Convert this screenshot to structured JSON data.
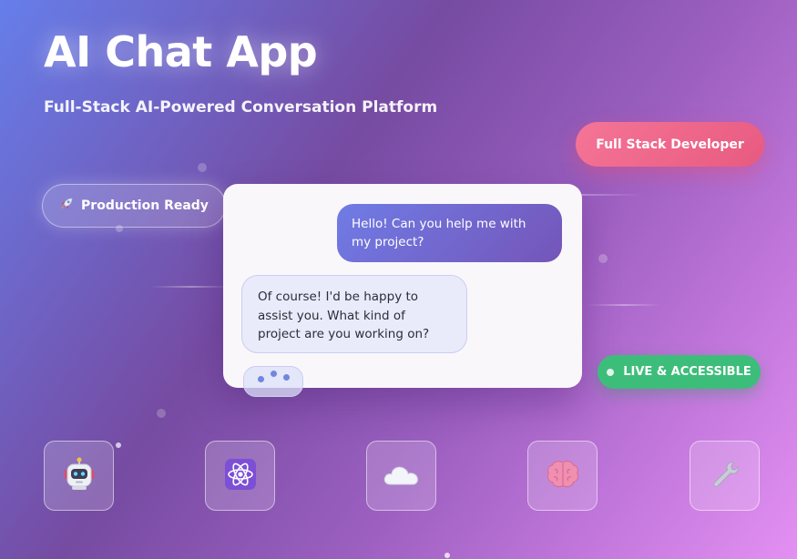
{
  "header": {
    "title": "AI Chat App",
    "subtitle": "Full-Stack AI-Powered Conversation Platform"
  },
  "badges": {
    "role": "Full Stack Developer",
    "production": "Production Ready",
    "production_icon": "rocket-icon",
    "status": "LIVE & ACCESSIBLE"
  },
  "chat": {
    "messages": [
      {
        "sender": "user",
        "text": "Hello! Can you help me with my project?"
      },
      {
        "sender": "assistant",
        "text": "Of course! I'd be happy to assist you. What kind of project are you working on?"
      }
    ],
    "typing_indicator": true
  },
  "features": [
    {
      "icon": "robot-icon"
    },
    {
      "icon": "atom-icon"
    },
    {
      "icon": "cloud-icon"
    },
    {
      "icon": "brain-icon"
    },
    {
      "icon": "wrench-icon"
    }
  ],
  "colors": {
    "background_start": "#667eea",
    "background_mid": "#764ba2",
    "background_end": "#e390f2",
    "role_badge": "#f06b8f",
    "user_bubble_start": "#6f7ce6",
    "user_bubble_end": "#7555b8",
    "assistant_bubble": "#e9ebfa",
    "status_badge": "#3dbd7a"
  }
}
